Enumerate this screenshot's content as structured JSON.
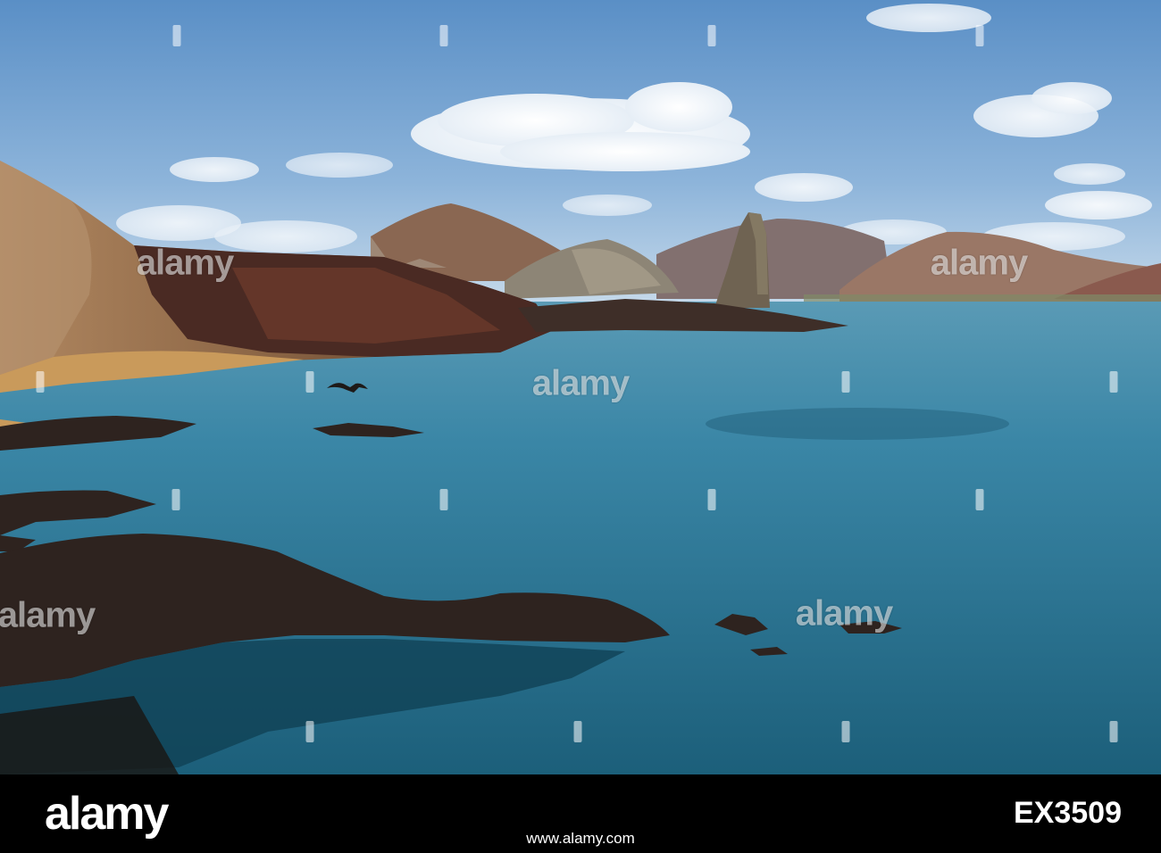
{
  "scene": {
    "subject": "volcanic islands",
    "colors": {
      "sky_top": "#5f93c8",
      "sky_bottom": "#b9d2e8",
      "sea_far": "#3f87a6",
      "sea_near": "#1f6680",
      "rock_dark": "#2f2420",
      "rock_red": "#5c3428",
      "sand": "#c99a5b",
      "hill": "#8d6a5a"
    }
  },
  "watermark": {
    "text": "alamy"
  },
  "footer": {
    "logo": "alamy",
    "image_id": "EX3509",
    "site": "www.alamy.com"
  }
}
